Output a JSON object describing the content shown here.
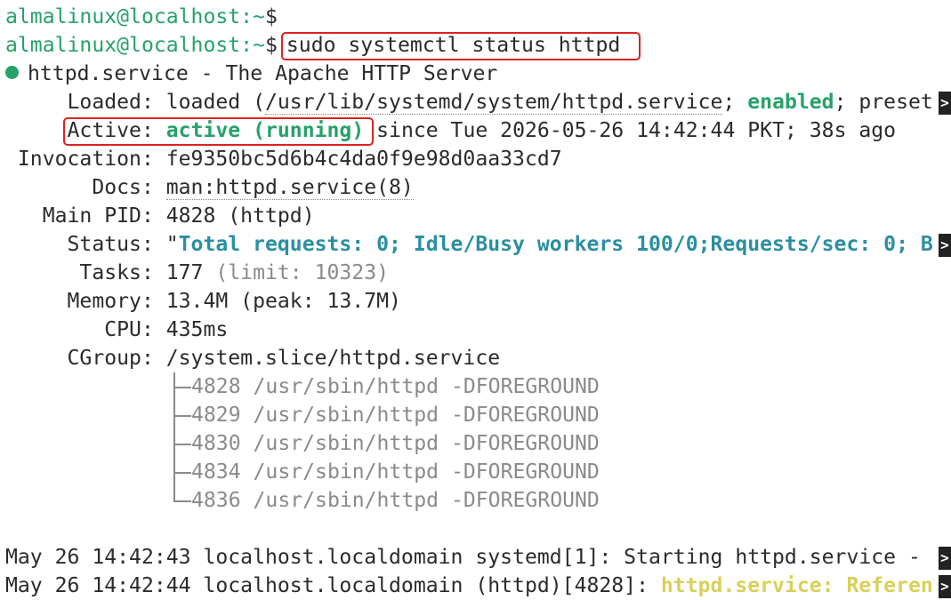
{
  "prompt": {
    "user_host": "almalinux@localhost",
    "path": ":~",
    "symbol": "$"
  },
  "command": "sudo systemctl status httpd",
  "service": {
    "name": "httpd.service",
    "description": " - The Apache HTTP Server"
  },
  "loaded": {
    "label": "     Loaded: ",
    "prefix": "loaded (",
    "path": "/usr/lib/systemd/system/httpd.service",
    "sep": "; ",
    "state": "enabled",
    "suffix": "; preset"
  },
  "active": {
    "label": "Active: ",
    "state": "active (running)",
    "since": " since Tue 2026-05-26 14:42:44 PKT; 38s ago"
  },
  "invocation": {
    "label": " Invocation: ",
    "value": "fe9350bc5d6b4c4da0f9e98d0aa33cd7"
  },
  "docs": {
    "label": "       Docs: ",
    "value": "man:httpd.service(8)"
  },
  "main_pid": {
    "label": "   Main PID: ",
    "value": "4828 (httpd)"
  },
  "status": {
    "label": "     Status: ",
    "quote": "\"",
    "value": "Total requests: 0; Idle/Busy workers 100/0;Requests/sec: 0; B"
  },
  "tasks": {
    "label": "      Tasks: ",
    "value": "177 ",
    "limit": "(limit: 10323)"
  },
  "memory": {
    "label": "     Memory: ",
    "value": "13.4M (peak: 13.7M)"
  },
  "cpu": {
    "label": "        CPU: ",
    "value": "435ms"
  },
  "cgroup": {
    "label": "     CGroup: ",
    "value": "/system.slice/httpd.service",
    "processes": [
      "4828 /usr/sbin/httpd -DFOREGROUND",
      "4829 /usr/sbin/httpd -DFOREGROUND",
      "4830 /usr/sbin/httpd -DFOREGROUND",
      "4834 /usr/sbin/httpd -DFOREGROUND",
      "4836 /usr/sbin/httpd -DFOREGROUND"
    ]
  },
  "logs": [
    {
      "prefix": "May 26 14:42:43 localhost.localdomain systemd[1]: Starting httpd.service - ",
      "highlight": ""
    },
    {
      "prefix": "May 26 14:42:44 localhost.localdomain (httpd)[4828]: ",
      "highlight": "httpd.service: Referen"
    }
  ],
  "truncation_glyph": ">",
  "colors": {
    "prompt": "#26a269",
    "highlight_box": "#e02020",
    "status_text": "#2a8fa0",
    "log_warning": "#d8d05a"
  }
}
